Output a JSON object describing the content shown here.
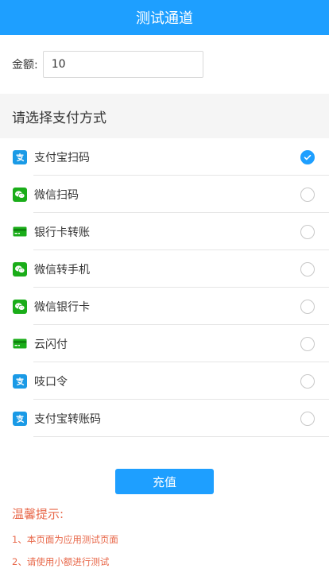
{
  "header": {
    "title": "测试通道"
  },
  "amount": {
    "label": "金额:",
    "value": "10"
  },
  "methods_section": {
    "title": "请选择支付方式"
  },
  "methods": [
    {
      "label": "支付宝扫码",
      "icon": "alipay-icon",
      "selected": true
    },
    {
      "label": "微信扫码",
      "icon": "wechat-icon",
      "selected": false
    },
    {
      "label": "银行卡转账",
      "icon": "bank-card-icon",
      "selected": false
    },
    {
      "label": "微信转手机",
      "icon": "wechat-icon",
      "selected": false
    },
    {
      "label": "微信银行卡",
      "icon": "wechat-icon",
      "selected": false
    },
    {
      "label": "云闪付",
      "icon": "bank-card-icon",
      "selected": false
    },
    {
      "label": "吱口令",
      "icon": "alipay-icon",
      "selected": false
    },
    {
      "label": "支付宝转账码",
      "icon": "alipay-icon",
      "selected": false
    }
  ],
  "submit": {
    "label": "充值"
  },
  "tips": {
    "title": "温馨提示:",
    "lines": [
      "1、本页面为应用测试页面",
      "2、请使用小额进行测试"
    ]
  },
  "colors": {
    "primary": "#1E9FFF",
    "alipay": "#1a9ae6",
    "wechat": "#1aad19",
    "tip": "#e8684a"
  }
}
